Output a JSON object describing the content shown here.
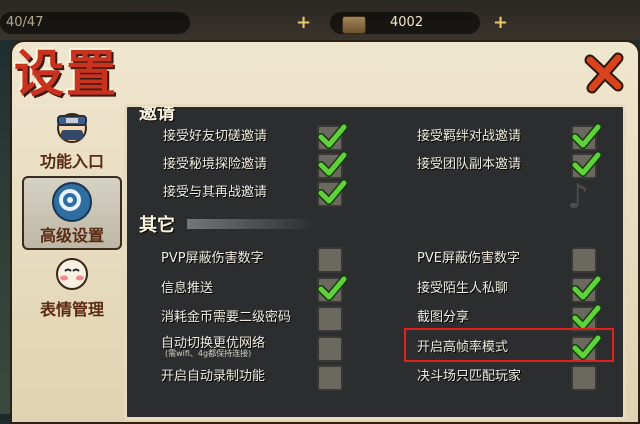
{
  "top_bar": {
    "resource_left": "40/47",
    "resource_right": "4002",
    "plus_glyph": "+"
  },
  "header": {
    "title": "设置",
    "close_label": "关闭"
  },
  "sidebar": {
    "items": [
      {
        "label": "功能入口",
        "active": false
      },
      {
        "label": "高级设置",
        "active": true
      },
      {
        "label": "表情管理",
        "active": false
      }
    ]
  },
  "sections": {
    "invite_title": "邀请",
    "other_title": "其它"
  },
  "invite_options": [
    {
      "label": "接受好友切磋邀请",
      "checked": true
    },
    {
      "label": "接受羁绊对战邀请",
      "checked": true
    },
    {
      "label": "接受秘境探险邀请",
      "checked": true
    },
    {
      "label": "接受团队副本邀请",
      "checked": true
    },
    {
      "label": "接受与其再战邀请",
      "checked": true
    }
  ],
  "other_options": [
    {
      "label": "PVP屏蔽伤害数字",
      "checked": false
    },
    {
      "label": "PVE屏蔽伤害数字",
      "checked": false
    },
    {
      "label": "信息推送",
      "checked": true
    },
    {
      "label": "接受陌生人私聊",
      "checked": true
    },
    {
      "label": "消耗金币需要二级密码",
      "checked": false
    },
    {
      "label": "截图分享",
      "checked": true
    },
    {
      "label": "自动切换更优网络",
      "sublabel": "(需wifi、4g都保持连接)",
      "checked": false
    },
    {
      "label": "开启高帧率模式",
      "checked": true
    },
    {
      "label": "开启自动录制功能",
      "checked": false
    },
    {
      "label": "决斗场只匹配玩家",
      "checked": false
    }
  ],
  "colors": {
    "title": "#c9321e",
    "check": "#5fd23a",
    "highlight": "#e0201a"
  }
}
